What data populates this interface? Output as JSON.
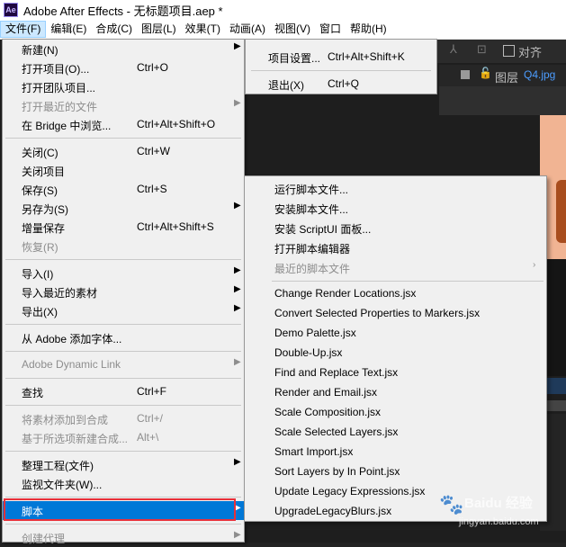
{
  "window": {
    "title": "Adobe After Effects - 无标题项目.aep *",
    "app_icon": "Ae"
  },
  "menubar": {
    "items": [
      {
        "label": "文件(F)"
      },
      {
        "label": "编辑(E)"
      },
      {
        "label": "合成(C)"
      },
      {
        "label": "图层(L)"
      },
      {
        "label": "效果(T)"
      },
      {
        "label": "动画(A)"
      },
      {
        "label": "视图(V)"
      },
      {
        "label": "窗口"
      },
      {
        "label": "帮助(H)"
      }
    ]
  },
  "file_menu": {
    "items": [
      {
        "label": "新建(N)",
        "shortcut": "",
        "arrow": "▶"
      },
      {
        "label": "打开项目(O)...",
        "shortcut": "Ctrl+O",
        "arrow": ""
      },
      {
        "label": "打开团队项目...",
        "shortcut": "",
        "arrow": ""
      },
      {
        "label": "打开最近的文件",
        "shortcut": "",
        "arrow": "▶"
      },
      {
        "label": "在 Bridge 中浏览...",
        "shortcut": "Ctrl+Alt+Shift+O",
        "arrow": ""
      },
      {
        "label": "关闭(C)",
        "shortcut": "Ctrl+W",
        "arrow": ""
      },
      {
        "label": "关闭项目",
        "shortcut": "",
        "arrow": ""
      },
      {
        "label": "保存(S)",
        "shortcut": "Ctrl+S",
        "arrow": ""
      },
      {
        "label": "另存为(S)",
        "shortcut": "",
        "arrow": "▶"
      },
      {
        "label": "增量保存",
        "shortcut": "Ctrl+Alt+Shift+S",
        "arrow": ""
      },
      {
        "label": "恢复(R)",
        "shortcut": "",
        "arrow": ""
      },
      {
        "label": "导入(I)",
        "shortcut": "",
        "arrow": "▶"
      },
      {
        "label": "导入最近的素材",
        "shortcut": "",
        "arrow": "▶"
      },
      {
        "label": "导出(X)",
        "shortcut": "",
        "arrow": "▶"
      },
      {
        "label": "从 Adobe 添加字体...",
        "shortcut": "",
        "arrow": ""
      },
      {
        "label": "Adobe Dynamic Link",
        "shortcut": "",
        "arrow": "▶"
      },
      {
        "label": "查找",
        "shortcut": "Ctrl+F",
        "arrow": ""
      },
      {
        "label": "将素材添加到合成",
        "shortcut": "Ctrl+/",
        "arrow": ""
      },
      {
        "label": "基于所选项新建合成...",
        "shortcut": "Alt+\\",
        "arrow": ""
      },
      {
        "label": "整理工程(文件)",
        "shortcut": "",
        "arrow": "▶"
      },
      {
        "label": "监视文件夹(W)...",
        "shortcut": "",
        "arrow": ""
      },
      {
        "label": "脚本",
        "shortcut": "",
        "arrow": "▶"
      },
      {
        "label": "创建代理",
        "shortcut": "",
        "arrow": "▶"
      }
    ]
  },
  "right_panel": {
    "items": [
      {
        "label": "项目设置...",
        "shortcut": "Ctrl+Alt+Shift+K"
      },
      {
        "label": "退出(X)",
        "shortcut": "Ctrl+Q"
      }
    ]
  },
  "script_menu": {
    "items": [
      {
        "label": "运行脚本文件...",
        "arrow": ""
      },
      {
        "label": "安装脚本文件...",
        "arrow": ""
      },
      {
        "label": "安装 ScriptUI 面板...",
        "arrow": ""
      },
      {
        "label": "打开脚本编辑器",
        "arrow": ""
      },
      {
        "label": "最近的脚本文件",
        "arrow": "›"
      },
      {
        "label": "Change Render Locations.jsx",
        "arrow": ""
      },
      {
        "label": "Convert Selected Properties to Markers.jsx",
        "arrow": ""
      },
      {
        "label": "Demo Palette.jsx",
        "arrow": ""
      },
      {
        "label": "Double-Up.jsx",
        "arrow": ""
      },
      {
        "label": "Find and Replace Text.jsx",
        "arrow": ""
      },
      {
        "label": "Render and Email.jsx",
        "arrow": ""
      },
      {
        "label": "Scale Composition.jsx",
        "arrow": ""
      },
      {
        "label": "Scale Selected Layers.jsx",
        "arrow": ""
      },
      {
        "label": "Smart Import.jsx",
        "arrow": ""
      },
      {
        "label": "Sort Layers by In Point.jsx",
        "arrow": ""
      },
      {
        "label": "Update Legacy Expressions.jsx",
        "arrow": ""
      },
      {
        "label": "UpgradeLegacyBlurs.jsx",
        "arrow": ""
      }
    ]
  },
  "background_panel": {
    "align_label": "对齐",
    "layer_label": "图层",
    "layer_name": "Q4.jpg",
    "tool_glyph_1": "⅄",
    "tool_glyph_2": "⊡",
    "lock_icon": "🔓"
  },
  "watermark": {
    "line1": "Baidu 经验",
    "line2": "jingyan.baidu.com",
    "paw": "🐾"
  },
  "colors": {
    "highlight": "#0078d7",
    "callout": "#e8303a",
    "layer_name": "#4c9dff"
  }
}
